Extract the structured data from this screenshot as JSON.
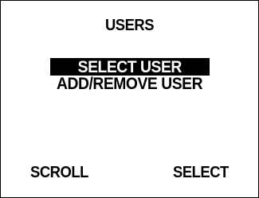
{
  "screen": {
    "title": "USERS"
  },
  "menu": {
    "items": [
      {
        "label": "SELECT USER",
        "selected": true
      },
      {
        "label": "ADD/REMOVE USER",
        "selected": false
      }
    ]
  },
  "softkeys": {
    "left_label": "SCROLL",
    "right_label": "SELECT"
  },
  "colors": {
    "background": "#ffffff",
    "foreground": "#000000",
    "highlight_background": "#000000",
    "highlight_text": "#ffffff"
  }
}
